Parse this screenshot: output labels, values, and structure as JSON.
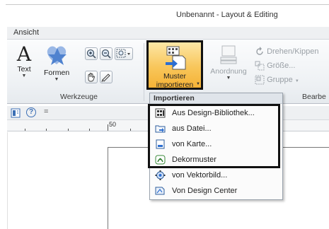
{
  "window": {
    "title": "Unbenannt - Layout & Editing"
  },
  "menu": {
    "ansicht": "Ansicht"
  },
  "ribbon": {
    "text_label": "Text",
    "formen_label": "Formen",
    "werkzeuge_group": "Werkzeuge",
    "muster_line1": "Muster",
    "muster_line2": "importieren",
    "anordnung_label": "Anordnung",
    "drehen_label": "Drehen/Kippen",
    "groesse_label": "Größe...",
    "gruppe_label": "Gruppe",
    "bearbeiten_group": "Bearbe"
  },
  "toolbar": {
    "more_glyph": "="
  },
  "ruler": {
    "mark_50": "50"
  },
  "dropdown": {
    "header": "Importieren",
    "items": [
      {
        "label": "Aus Design-Bibliothek...",
        "icon": "library-grid-icon"
      },
      {
        "label": "aus Datei...",
        "icon": "folder-arrow-icon"
      },
      {
        "label": "von Karte...",
        "icon": "card-icon"
      },
      {
        "label": "Dekormuster",
        "icon": "decor-pattern-icon"
      },
      {
        "label": "von Vektorbild...",
        "icon": "vector-image-icon"
      },
      {
        "label": "Von Design Center",
        "icon": "design-center-icon"
      }
    ]
  },
  "colors": {
    "accent": "#f8c65a",
    "star": "#5b8fd6"
  }
}
